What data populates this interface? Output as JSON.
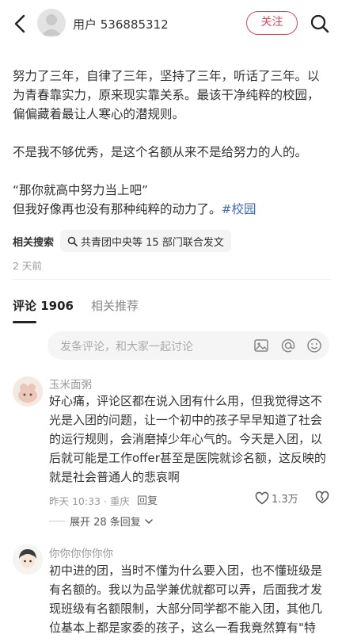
{
  "header": {
    "username": "用户 536885312",
    "follow_label": "关注"
  },
  "post": {
    "paragraph1": "努力了三年，自律了三年，坚持了三年，听话了三年。以为青春靠实力，原来现实靠关系。最该干净纯粹的校园，偏偏藏着最让人寒心的潜规则。",
    "paragraph2": "不是我不够优秀，是这个名额从来不是给努力的人的。",
    "quote": "“那你就高中努力当上吧”",
    "line4": "但我好像再也没有那种纯粹的动力了。",
    "hashtag": "#校园",
    "related_label": "相关搜索",
    "related_query": "共青团中央等 15 部门联合发文",
    "time_ago": "2 天前"
  },
  "tabs": {
    "comments": "评论 1906",
    "recommend": "相关推荐"
  },
  "comment_input": {
    "placeholder": "发条评论，和大家一起讨论"
  },
  "comments": [
    {
      "name": "玉米面粥",
      "text": "好心痛，评论区都在说入团有什么用，但我觉得这不光是入团的问题，让一个初中的孩子早早知道了社会的运行规则，会消磨掉少年心气的。今天是入团，以后就可能是工作offer甚至是医院就诊名额，这反映的就是社会普通人的悲哀啊",
      "time": "昨天 10:33 · 重庆",
      "reply_label": "回复",
      "likes": "1.3万",
      "expand_label": "展开 28 条回复"
    },
    {
      "name": "你你你你你你",
      "text": "初中进的团，当时不懂为什么要入团，也不懂班级是有名额的。我以为品学兼优就都可以弄，后面我才发现班级有名额限制，大部分同学都不能入团，其他几位基本上都是家委的孩子，这么一看我竟然算有\"特殊\"行列"
    }
  ],
  "colors": {
    "accent": "#e0465b",
    "link": "#3d6eb5"
  },
  "icons": [
    "back-arrow-icon",
    "search-icon",
    "magnifier-icon",
    "image-icon",
    "at-icon",
    "emoji-icon",
    "heart-icon",
    "broken-heart-icon",
    "chevron-down-icon"
  ]
}
